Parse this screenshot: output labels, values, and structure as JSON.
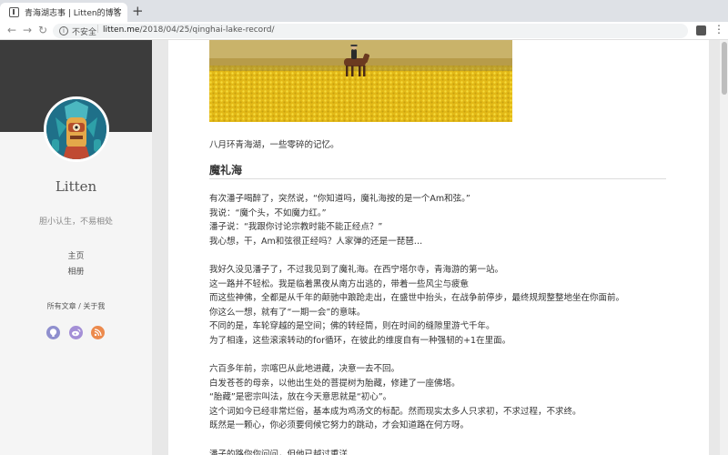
{
  "browser": {
    "tab_title": "青海湖志事 | Litten的博客",
    "tab_close": "×",
    "new_tab": "+",
    "security_label": "不安全",
    "url_separator": "|",
    "url_host": "litten.me",
    "url_path": "/2018/04/25/qinghai-lake-record/"
  },
  "sidebar": {
    "blog_name": "Litten",
    "tagline": "胆小认生，不易相处",
    "nav": [
      {
        "label": "主页"
      },
      {
        "label": "相册"
      }
    ],
    "links": {
      "all_posts": "所有文章",
      "separator": "/",
      "about": "关于我"
    },
    "social": [
      {
        "icon": "github-icon",
        "color": "#8f8fce"
      },
      {
        "icon": "weibo-icon",
        "color": "#a48fd6"
      },
      {
        "icon": "rss-icon",
        "color": "#ec8a4d"
      }
    ]
  },
  "article": {
    "intro": "八月环青海湖，一些零碎的记忆。",
    "section_title": "魔礼海",
    "paragraphs": [
      [
        "有次潘子喝醉了，突然说，“你知道吗，魔礼海按的是一个Am和弦。”",
        "我说：“魔个头，不如魔力红。”",
        "潘子说：“我跟你讨论宗教时能不能正经点？”",
        "我心想，干，Am和弦很正经吗？人家弹的还是一琵琶…"
      ],
      [
        "我好久没见潘子了，不过我见到了魔礼海。在西宁塔尔寺，青海游的第一站。",
        "这一路并不轻松。我是临着黑夜从南方出逃的，带着一些风尘与疲惫",
        "而这些神佛，全都是从千年的颠驰中踉跄走出，在盛世中抬头，在战争前停步，最终规规整整地坐在你面前。",
        "你这么一想，就有了“一期一会”的意味。",
        "不同的是，车轮穿越的是空间；佛的转经筒，则在时间的缝隙里游弋千年。",
        "为了相逢，这些滚滚转动的for循环，在彼此的维度自有一种强韧的+1在里面。"
      ],
      [
        "六百多年前，宗喀巴从此地进藏，决意一去不回。",
        "白发苍苍的母亲，以他出生处的菩提树为胎藏，修建了一座佛塔。",
        "“胎藏”是密宗叫法，放在今天意思就是“初心”。",
        "这个词如今已经非常烂俗，基本成为鸡汤文的标配。然而现实太多人只求初，不求过程，不求终。",
        "既然是一颗心，你必须要伺候它努力的跳动，才会知道路在何方呀。"
      ],
      [
        "潘子的路你你问问，但他已越过重洋"
      ]
    ]
  },
  "colors": {
    "sidebar_header": "#3c3c3c",
    "sidebar_bg": "#f5f5f5",
    "canola_yellow": "#e8c21f",
    "text": "#333333"
  }
}
